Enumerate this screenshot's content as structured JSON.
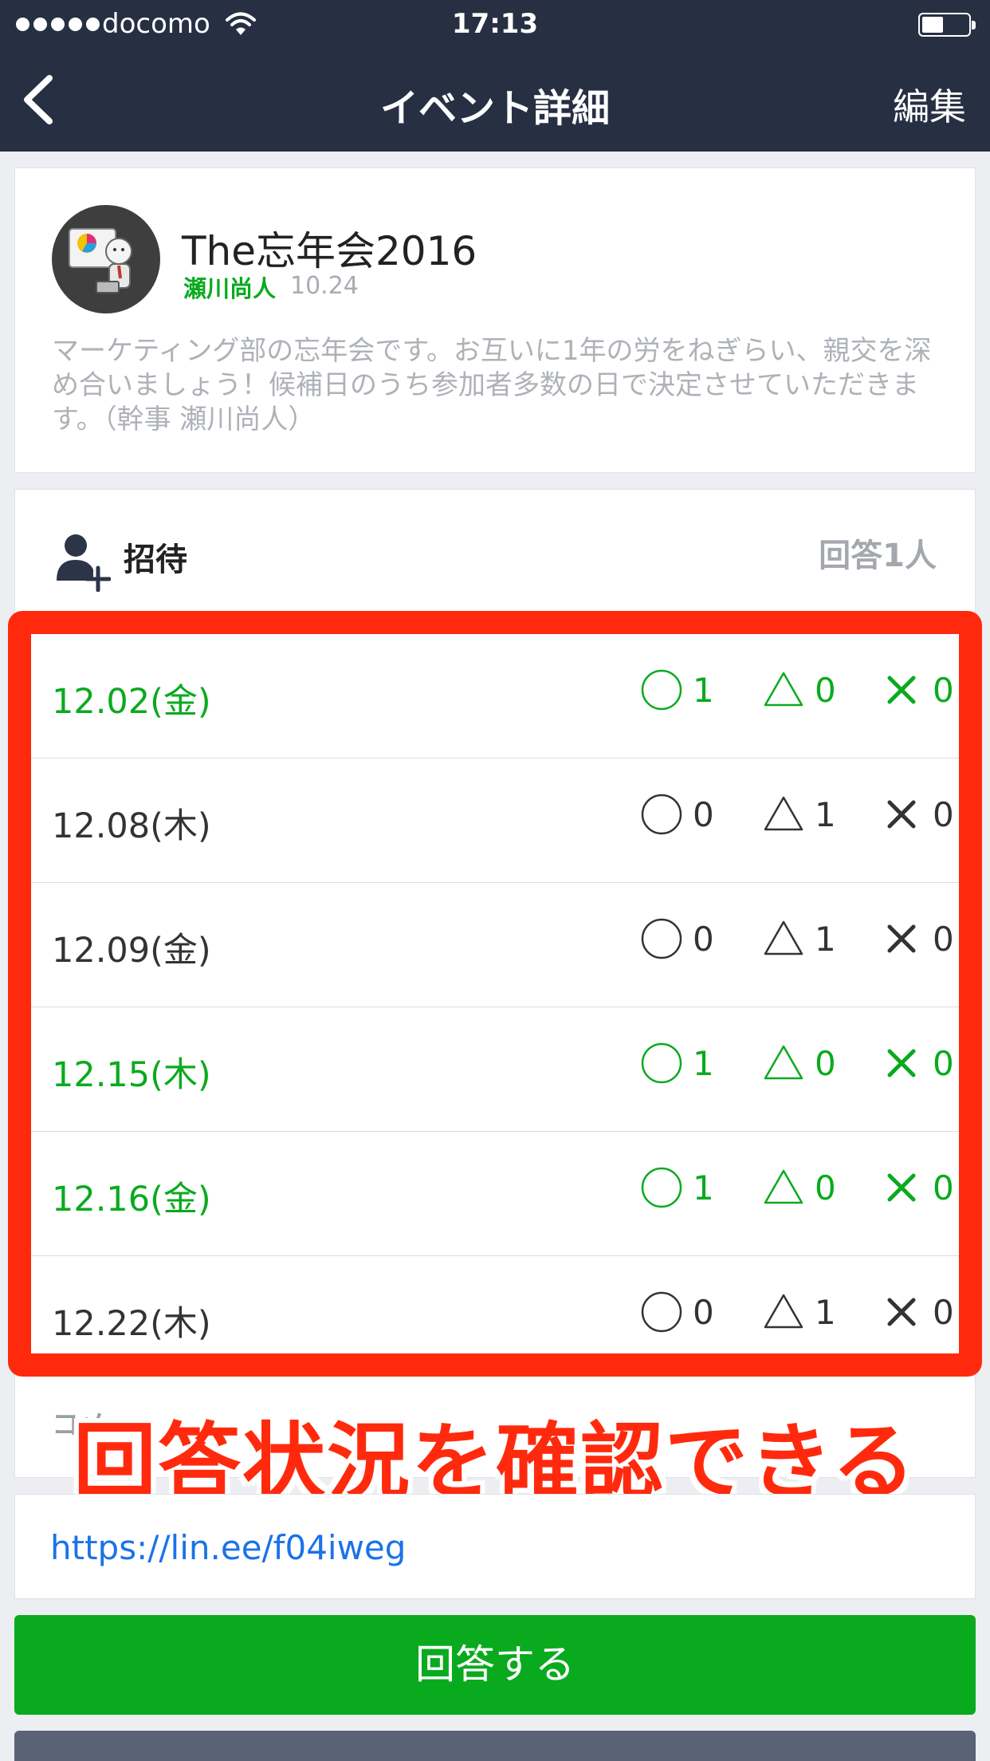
{
  "status_bar": {
    "carrier": "docomo",
    "time": "17:13"
  },
  "nav": {
    "title": "イベント詳細",
    "edit_label": "編集"
  },
  "event": {
    "title": "The忘年会2016",
    "organizer": "瀬川尚人",
    "date": "10.24",
    "description": "マーケティング部の忘年会です。お互いに1年の労をねぎらい、親交を深め合いましょう！候補日のうち参加者多数の日で決定させていただきます。（幹事 瀬川尚人）"
  },
  "invite": {
    "label": "招待",
    "answer_count": "回答1人",
    "comment_label": "コメ"
  },
  "dates": [
    {
      "date": "12.02(金)",
      "yes": "1",
      "maybe": "0",
      "no": "0",
      "highlight": true
    },
    {
      "date": "12.08(木)",
      "yes": "0",
      "maybe": "1",
      "no": "0",
      "highlight": false
    },
    {
      "date": "12.09(金)",
      "yes": "0",
      "maybe": "1",
      "no": "0",
      "highlight": false
    },
    {
      "date": "12.15(木)",
      "yes": "1",
      "maybe": "0",
      "no": "0",
      "highlight": true
    },
    {
      "date": "12.16(金)",
      "yes": "1",
      "maybe": "0",
      "no": "0",
      "highlight": true
    },
    {
      "date": "12.22(木)",
      "yes": "0",
      "maybe": "1",
      "no": "0",
      "highlight": false
    }
  ],
  "caption": "回答状況を確認できる",
  "link": "https://lin.ee/f04iweg",
  "answer_button": "回答する",
  "colors": {
    "nav_bg": "#273043",
    "accent_green": "#0aaa1e",
    "highlight_red": "#ff2a0d",
    "link_blue": "#1a73e8"
  }
}
